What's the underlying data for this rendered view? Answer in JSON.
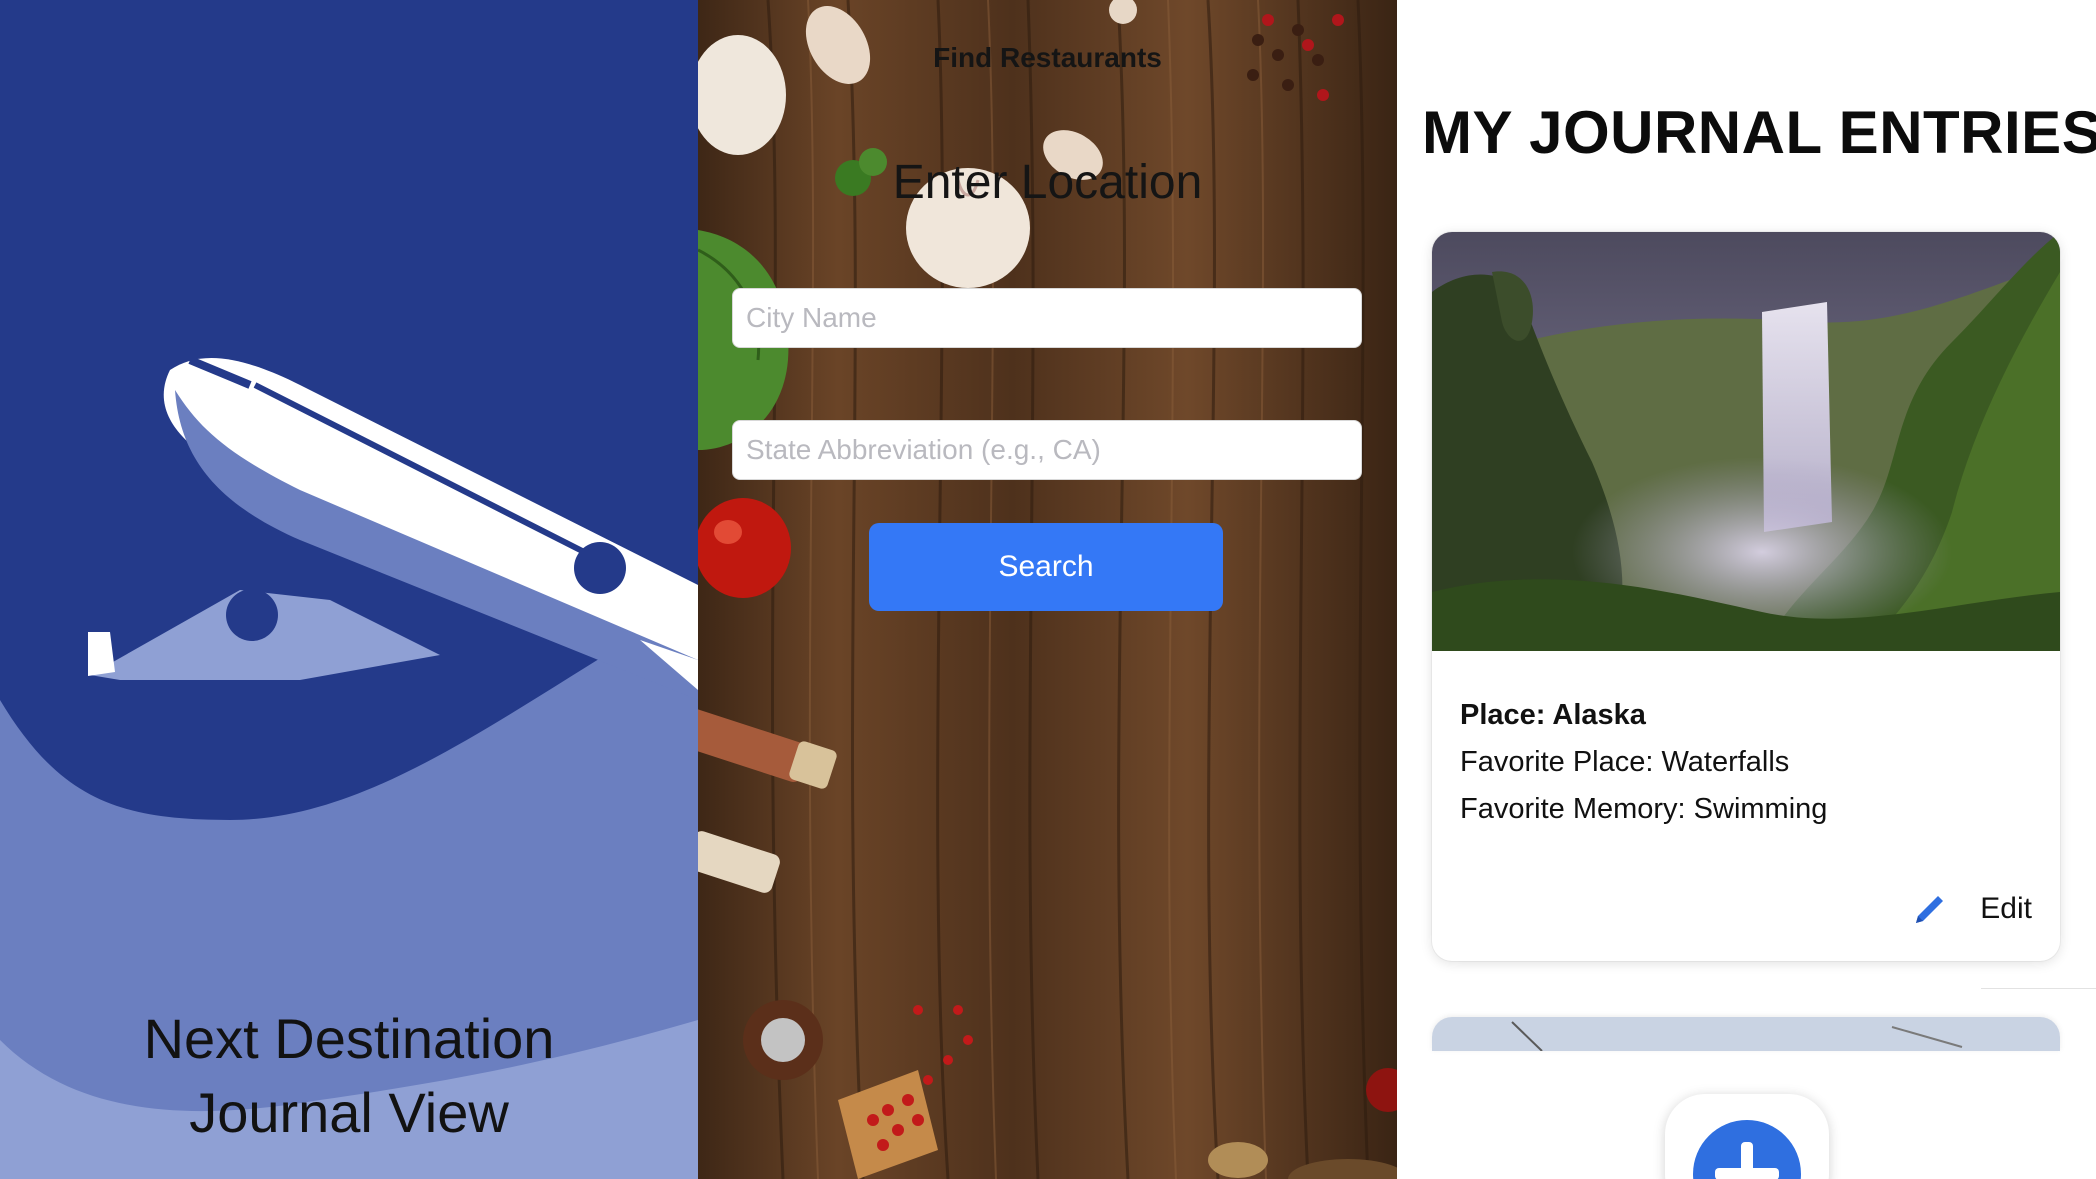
{
  "splash": {
    "title_line1": "Next Destination",
    "title_line2": "Journal View",
    "background_color": "#243a8a",
    "accent_color": "#6b7fc0"
  },
  "find_restaurants": {
    "nav_title": "Find Restaurants",
    "heading": "Enter Location",
    "city_field": {
      "value": "",
      "placeholder": "City Name"
    },
    "state_field": {
      "value": "",
      "placeholder": "State Abbreviation (e.g., CA)"
    },
    "search_label": "Search",
    "button_color": "#3478f6"
  },
  "journal": {
    "title": "MY JOURNAL ENTRIES",
    "entries": [
      {
        "place": "Place: Alaska",
        "favorite_place": "Favorite Place: Waterfalls",
        "favorite_memory": "Favorite Memory: Swimming",
        "edit_label": "Edit",
        "edit_icon": "pencil-icon",
        "photo": "waterfall-photo"
      }
    ],
    "add_icon": "plus-icon",
    "accent_color": "#2f6fe0"
  }
}
